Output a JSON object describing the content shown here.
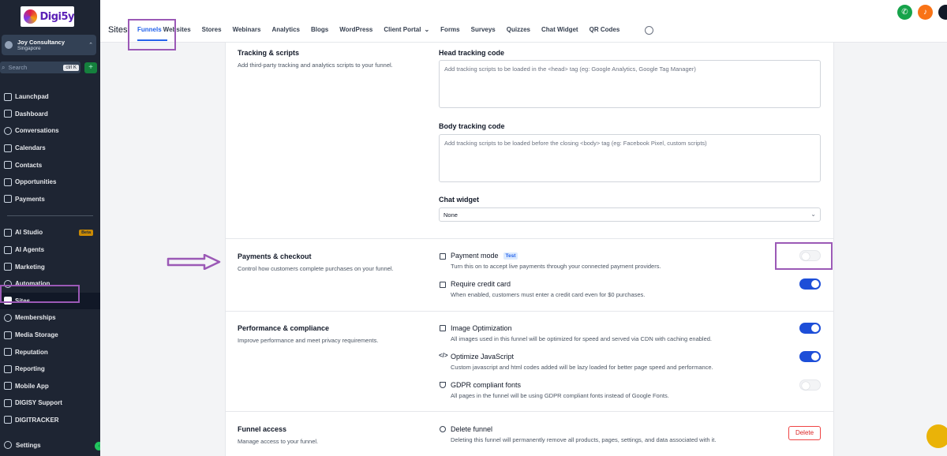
{
  "brand": {
    "logo_text": "Digi5y"
  },
  "account": {
    "name": "Joy Consultancy",
    "location": "Singapore"
  },
  "search": {
    "placeholder": "Search",
    "shortcut": "ctrl K"
  },
  "sidebar": {
    "items": [
      {
        "label": "Launchpad",
        "icon": "rocket-icon"
      },
      {
        "label": "Dashboard",
        "icon": "grid-icon"
      },
      {
        "label": "Conversations",
        "icon": "chat-icon"
      },
      {
        "label": "Calendars",
        "icon": "calendar-icon"
      },
      {
        "label": "Contacts",
        "icon": "contacts-icon"
      },
      {
        "label": "Opportunities",
        "icon": "funnel-icon"
      },
      {
        "label": "Payments",
        "icon": "payments-icon"
      }
    ],
    "items2": [
      {
        "label": "AI Studio",
        "icon": "ai-studio-icon",
        "badge": "Beta"
      },
      {
        "label": "AI Agents",
        "icon": "ai-agents-icon"
      },
      {
        "label": "Marketing",
        "icon": "marketing-icon"
      },
      {
        "label": "Automation",
        "icon": "automation-icon"
      },
      {
        "label": "Sites",
        "icon": "sites-icon",
        "active": true
      },
      {
        "label": "Memberships",
        "icon": "memberships-icon"
      },
      {
        "label": "Media Storage",
        "icon": "media-icon"
      },
      {
        "label": "Reputation",
        "icon": "star-icon"
      },
      {
        "label": "Reporting",
        "icon": "reporting-icon"
      },
      {
        "label": "Mobile App",
        "icon": "mobile-icon"
      },
      {
        "label": "DIGISY Support",
        "icon": "support-icon"
      },
      {
        "label": "DIGITRACKER",
        "icon": "tracker-icon"
      }
    ],
    "settings_label": "Settings"
  },
  "topbar": {
    "title": "Sites",
    "tabs": [
      "Funnels",
      "Websites",
      "Stores",
      "Webinars",
      "Analytics",
      "Blogs",
      "WordPress",
      "Client Portal",
      "Forms",
      "Surveys",
      "Quizzes",
      "Chat Widget",
      "QR Codes"
    ],
    "active_tab": "Funnels"
  },
  "sections": {
    "tracking": {
      "title": "Tracking & scripts",
      "desc": "Add third-party tracking and analytics scripts to your funnel.",
      "head_label": "Head tracking code",
      "head_placeholder": "Add tracking scripts to be loaded in the <head> tag (eg: Google Analytics, Google Tag Manager)",
      "body_label": "Body tracking code",
      "body_placeholder": "Add tracking scripts to be loaded before the closing <body> tag (eg: Facebook Pixel, custom scripts)",
      "chat_label": "Chat widget",
      "chat_value": "None"
    },
    "payments": {
      "title": "Payments & checkout",
      "desc": "Control how customers complete purchases on your funnel.",
      "payment_mode_title": "Payment mode",
      "payment_mode_badge": "Test",
      "payment_mode_desc": "Turn this on to accept live payments through your connected payment providers.",
      "payment_mode_on": false,
      "credit_card_title": "Require credit card",
      "credit_card_desc": "When enabled, customers must enter a credit card even for $0 purchases.",
      "credit_card_on": true
    },
    "performance": {
      "title": "Performance & compliance",
      "desc": "Improve performance and meet privacy requirements.",
      "image_opt_title": "Image Optimization",
      "image_opt_desc": "All images used in this funnel will be optimized for speed and served via CDN with caching enabled.",
      "image_opt_on": true,
      "js_title": "Optimize JavaScript",
      "js_desc": "Custom javascript and html codes added will be lazy loaded for better page speed and performance.",
      "js_on": true,
      "gdpr_title": "GDPR compliant fonts",
      "gdpr_desc": "All pages in the funnel will be using GDPR compliant fonts instead of Google Fonts.",
      "gdpr_on": false
    },
    "access": {
      "title": "Funnel access",
      "desc": "Manage access to your funnel.",
      "delete_title": "Delete funnel",
      "delete_desc": "Deleting this funnel will permanently remove all products, pages, settings, and data associated with it.",
      "delete_button": "Delete"
    }
  },
  "colors": {
    "accent": "#2563eb",
    "toggle_on": "#1d4ed8",
    "sidebar_bg": "#1e2533",
    "highlight": "#9b59b6",
    "danger": "#dc2626"
  }
}
